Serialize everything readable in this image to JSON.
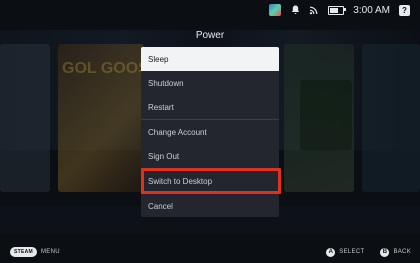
{
  "status_bar": {
    "time": "3:00 AM",
    "icons": [
      "profile-avatar",
      "notification-bell-icon",
      "wifi-icon",
      "battery-icon",
      "help-icon"
    ],
    "help_label": "?",
    "battery_level": 0.7
  },
  "power_menu": {
    "title": "Power",
    "items": [
      {
        "label": "Sleep",
        "selected": true
      },
      {
        "label": "Shutdown"
      },
      {
        "label": "Restart"
      },
      {
        "label": "Change Account"
      },
      {
        "label": "Sign Out"
      },
      {
        "label": "Switch to Desktop",
        "highlighted": true
      },
      {
        "label": "Cancel"
      }
    ]
  },
  "background": {
    "tile_text": "GOL GOOS DUC"
  },
  "footer": {
    "steam_button": "STEAM",
    "menu_label": "MENU",
    "a_button": "A",
    "select_label": "SELECT",
    "b_button": "B",
    "back_label": "BACK"
  },
  "colors": {
    "highlight_border": "#e0301e",
    "menu_bg": "#23262e",
    "selected_bg": "#f2f3f5"
  }
}
